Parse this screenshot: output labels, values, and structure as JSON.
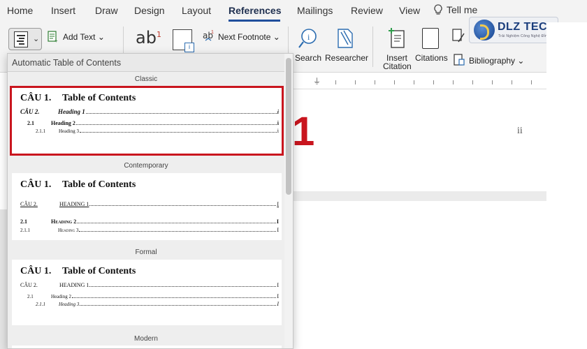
{
  "tabs": [
    {
      "label": "Home",
      "active": false
    },
    {
      "label": "Insert",
      "active": false
    },
    {
      "label": "Draw",
      "active": false
    },
    {
      "label": "Design",
      "active": false
    },
    {
      "label": "Layout",
      "active": false
    },
    {
      "label": "References",
      "active": true
    },
    {
      "label": "Mailings",
      "active": false
    },
    {
      "label": "Review",
      "active": false
    },
    {
      "label": "View",
      "active": false
    }
  ],
  "tell_me": "Tell me",
  "ribbon": {
    "add_text": "Add Text",
    "footnote_glyph": "ab",
    "footnote_sup": "1",
    "endnote_glyph": "i",
    "next_footnote": "Next Footnote",
    "search": "Search",
    "researcher": "Researcher",
    "insert_citation_line1": "Insert",
    "insert_citation_line2": "Citation",
    "citations": "Citations",
    "bibliography": "Bibliography"
  },
  "logo": {
    "text": "DLZ TECH",
    "tagline": "Trải Nghiệm Công Nghệ Đỉnh Cao"
  },
  "document": {
    "page_number": "ii",
    "annotation": "1"
  },
  "toc_panel": {
    "header": "Automatic Table of Contents",
    "sections": [
      {
        "label": "Classic",
        "selected": true,
        "heading_number": "CÂU 1.",
        "heading_text": "Table of Contents",
        "entries": [
          {
            "num": "CÂU 2.",
            "text": "Heading 1",
            "page": "i"
          },
          {
            "num": "2.1",
            "text": "Heading 2",
            "page": "i"
          },
          {
            "num": "2.1.1",
            "text": "Heading 3",
            "page": "i"
          }
        ]
      },
      {
        "label": "Contemporary",
        "selected": false,
        "heading_number": "CÂU 1.",
        "heading_text": "Table of Contents",
        "entries": [
          {
            "num": "CÂU 2.",
            "text": "HEADING 1",
            "page": "I"
          },
          {
            "num": "2.1",
            "text": "Heading 2",
            "page": "I"
          },
          {
            "num": "2.1.1",
            "text": "Heading 3",
            "page": "I"
          }
        ]
      },
      {
        "label": "Formal",
        "selected": false,
        "heading_number": "CÂU 1.",
        "heading_text": "Table of Contents",
        "entries": [
          {
            "num": "CÂU 2.",
            "text": "HEADING 1",
            "page": "I"
          },
          {
            "num": "2.1",
            "text": "Heading 2",
            "page": "I"
          },
          {
            "num": "2.1.1",
            "text": "Heading 3",
            "page": "I"
          }
        ]
      },
      {
        "label": "Modern",
        "selected": false
      }
    ]
  },
  "colors": {
    "accent": "#1f4e9c",
    "highlight": "#c9151e",
    "ribbon_bg": "#f3f3f3"
  }
}
